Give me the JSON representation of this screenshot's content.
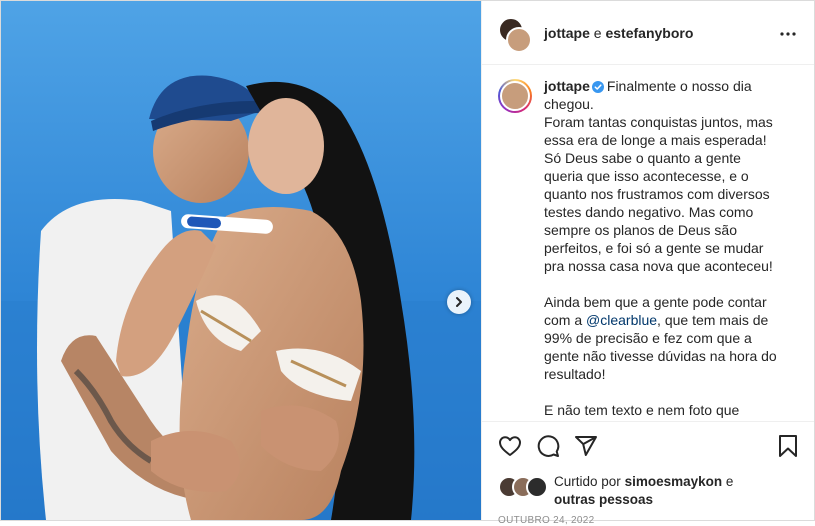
{
  "header": {
    "user1": "jottape",
    "conjunction": "e",
    "user2": "estefanyboro"
  },
  "caption": {
    "username": "jottape",
    "text": "Finalmente o nosso dia chegou.\nForam tantas conquistas juntos, mas essa era de longe a mais esperada! Só Deus sabe o quanto a gente queria que isso acontecesse, e o quanto nos frustramos com diversos testes dando negativo. Mas como sempre os planos de Deus são perfeitos, e foi só a gente se mudar pra nossa casa nova que aconteceu!\n\nAinda bem que a gente pode contar com a ",
    "mention": "@clearblue",
    "text_after": ", que tem mais de 99% de precisão e fez com que a gente não tivesse dúvidas na hora do resultado!\n\nE não tem texto e nem foto que"
  },
  "likes": {
    "prefix": "Curtido por",
    "user": "simoesmaykon",
    "and": "e",
    "others": "outras pessoas"
  },
  "date": "OUTUBRO 24, 2022",
  "icons": {
    "like": "heart-icon",
    "comment": "comment-icon",
    "share": "share-icon",
    "save": "bookmark-icon",
    "more": "more-options-icon",
    "next": "chevron-right-icon",
    "verified": "verified-badge-icon"
  },
  "colors": {
    "verified": "#3897f0",
    "text": "#262626",
    "mention": "#00376b",
    "muted": "#8e8e8e"
  }
}
